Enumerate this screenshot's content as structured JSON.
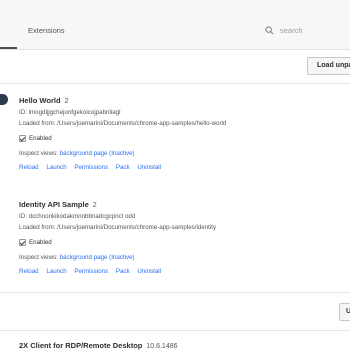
{
  "tabs": {
    "extensions_label": "Extensions"
  },
  "search": {
    "placeholder": "search"
  },
  "toolbar": {
    "load_unpacked_label": "Load unpa",
    "secondary_button_label": "U"
  },
  "extensions": [
    {
      "name": "Hello World",
      "version": "2",
      "id_line": "ID: lmogdljjgchejonfgekoicojpabnliagl",
      "loaded_from_line": "Loaded from: /Users/joemarini/Documents/chrome-app-samples/hello-world",
      "enabled_label": "Enabled",
      "inspect_prefix": "Inspect views:",
      "inspect_link": "background page (Inactive)",
      "actions": [
        "Reload",
        "Launch",
        "Permissions",
        "Pack",
        "Uninstall"
      ]
    },
    {
      "name": "Identity API Sample",
      "version": "2",
      "id_line": "ID: dcchnonkikodakmnnbbnadcgcpncl odd",
      "loaded_from_line": "Loaded from: /Users/joemarini/Documents/chrome-app-samples/identity",
      "enabled_label": "Enabled",
      "inspect_prefix": "Inspect views:",
      "inspect_link": "background page (Inactive)",
      "actions": [
        "Reload",
        "Launch",
        "Permissions",
        "Pack",
        "Uninstall"
      ]
    }
  ],
  "partial_item": {
    "name": "2X Client for RDP/Remote Desktop",
    "version": "10.6.1486"
  },
  "colors": {
    "link": "#2a6df4",
    "header_bg": "#f7f7f7"
  }
}
